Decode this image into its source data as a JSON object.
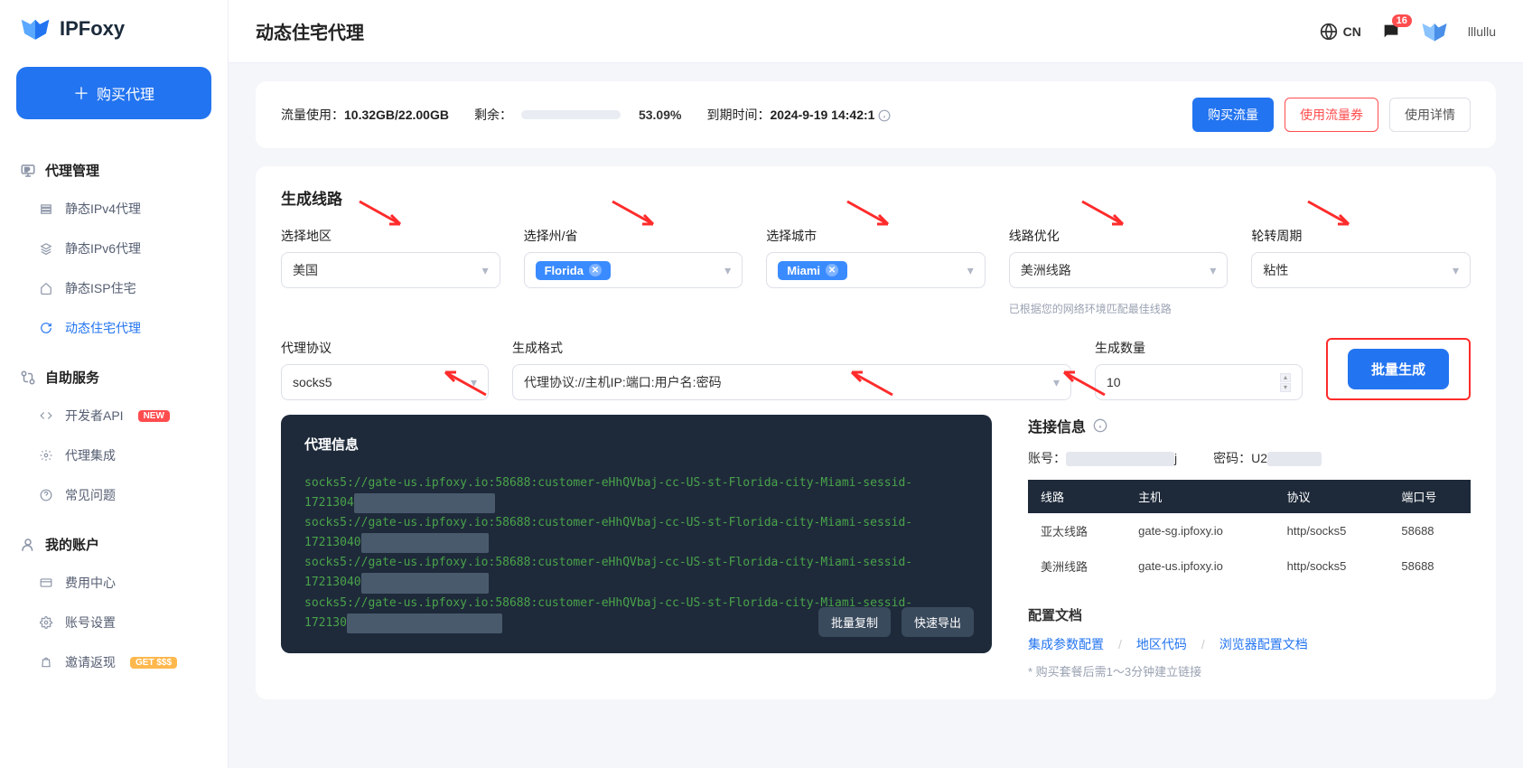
{
  "brand": "IPFoxy",
  "buy_proxy_label": "购买代理",
  "header": {
    "title": "动态住宅代理",
    "lang": "CN",
    "msg_count": "16",
    "username": "lllullu"
  },
  "nav": {
    "group1": "代理管理",
    "g1_items": [
      "静态IPv4代理",
      "静态IPv6代理",
      "静态ISP住宅",
      "动态住宅代理"
    ],
    "group2": "自助服务",
    "g2_items": [
      "开发者API",
      "代理集成",
      "常见问题"
    ],
    "g2_tag": "NEW",
    "group3": "我的账户",
    "g3_items": [
      "费用中心",
      "账号设置",
      "邀请返现"
    ],
    "g3_tag": "GET $$$"
  },
  "usage": {
    "traffic_label": "流量使用：",
    "traffic_value": "10.32GB/22.00GB",
    "remain_label": "剩余：",
    "percent": "53.09%",
    "expire_label": "到期时间：",
    "expire_value": "2024-9-19 14:42:1",
    "buy_traffic": "购买流量",
    "use_voucher": "使用流量券",
    "usage_detail": "使用详情"
  },
  "form": {
    "section_title": "生成线路",
    "region_label": "选择地区",
    "region_value": "美国",
    "state_label": "选择州/省",
    "state_value": "Florida",
    "city_label": "选择城市",
    "city_value": "Miami",
    "route_label": "线路优化",
    "route_value": "美洲线路",
    "route_hint": "已根据您的网络环境匹配最佳线路",
    "rotate_label": "轮转周期",
    "rotate_value": "粘性",
    "proto_label": "代理协议",
    "proto_value": "socks5",
    "format_label": "生成格式",
    "format_value": "代理协议://主机IP:端口:用户名:密码",
    "qty_label": "生成数量",
    "qty_value": "10",
    "gen_btn": "批量生成"
  },
  "proxy_info": {
    "title": "代理信息",
    "prefix": "socks5://gate-us.ipfoxy.io:58688:customer-eHhQVbaj-cc-US-st-Florida-city-Miami-sessid-",
    "line2_prefix": "1721304",
    "line2b_prefix": "17213040",
    "line2c_prefix": "172130",
    "copy_btn": "批量复制",
    "export_btn": "快速导出"
  },
  "conn": {
    "title": "连接信息",
    "account_label": "账号：",
    "account_suffix": "j",
    "pwd_label": "密码：",
    "pwd_prefix": "U2",
    "th_route": "线路",
    "th_host": "主机",
    "th_proto": "协议",
    "th_port": "端口号",
    "rows": [
      {
        "route": "亚太线路",
        "host": "gate-sg.ipfoxy.io",
        "proto": "http/socks5",
        "port": "58688"
      },
      {
        "route": "美洲线路",
        "host": "gate-us.ipfoxy.io",
        "proto": "http/socks5",
        "port": "58688"
      }
    ],
    "docs_title": "配置文档",
    "doc1": "集成参数配置",
    "doc2": "地区代码",
    "doc3": "浏览器配置文档",
    "note": "* 购买套餐后需1～3分钟建立链接"
  }
}
